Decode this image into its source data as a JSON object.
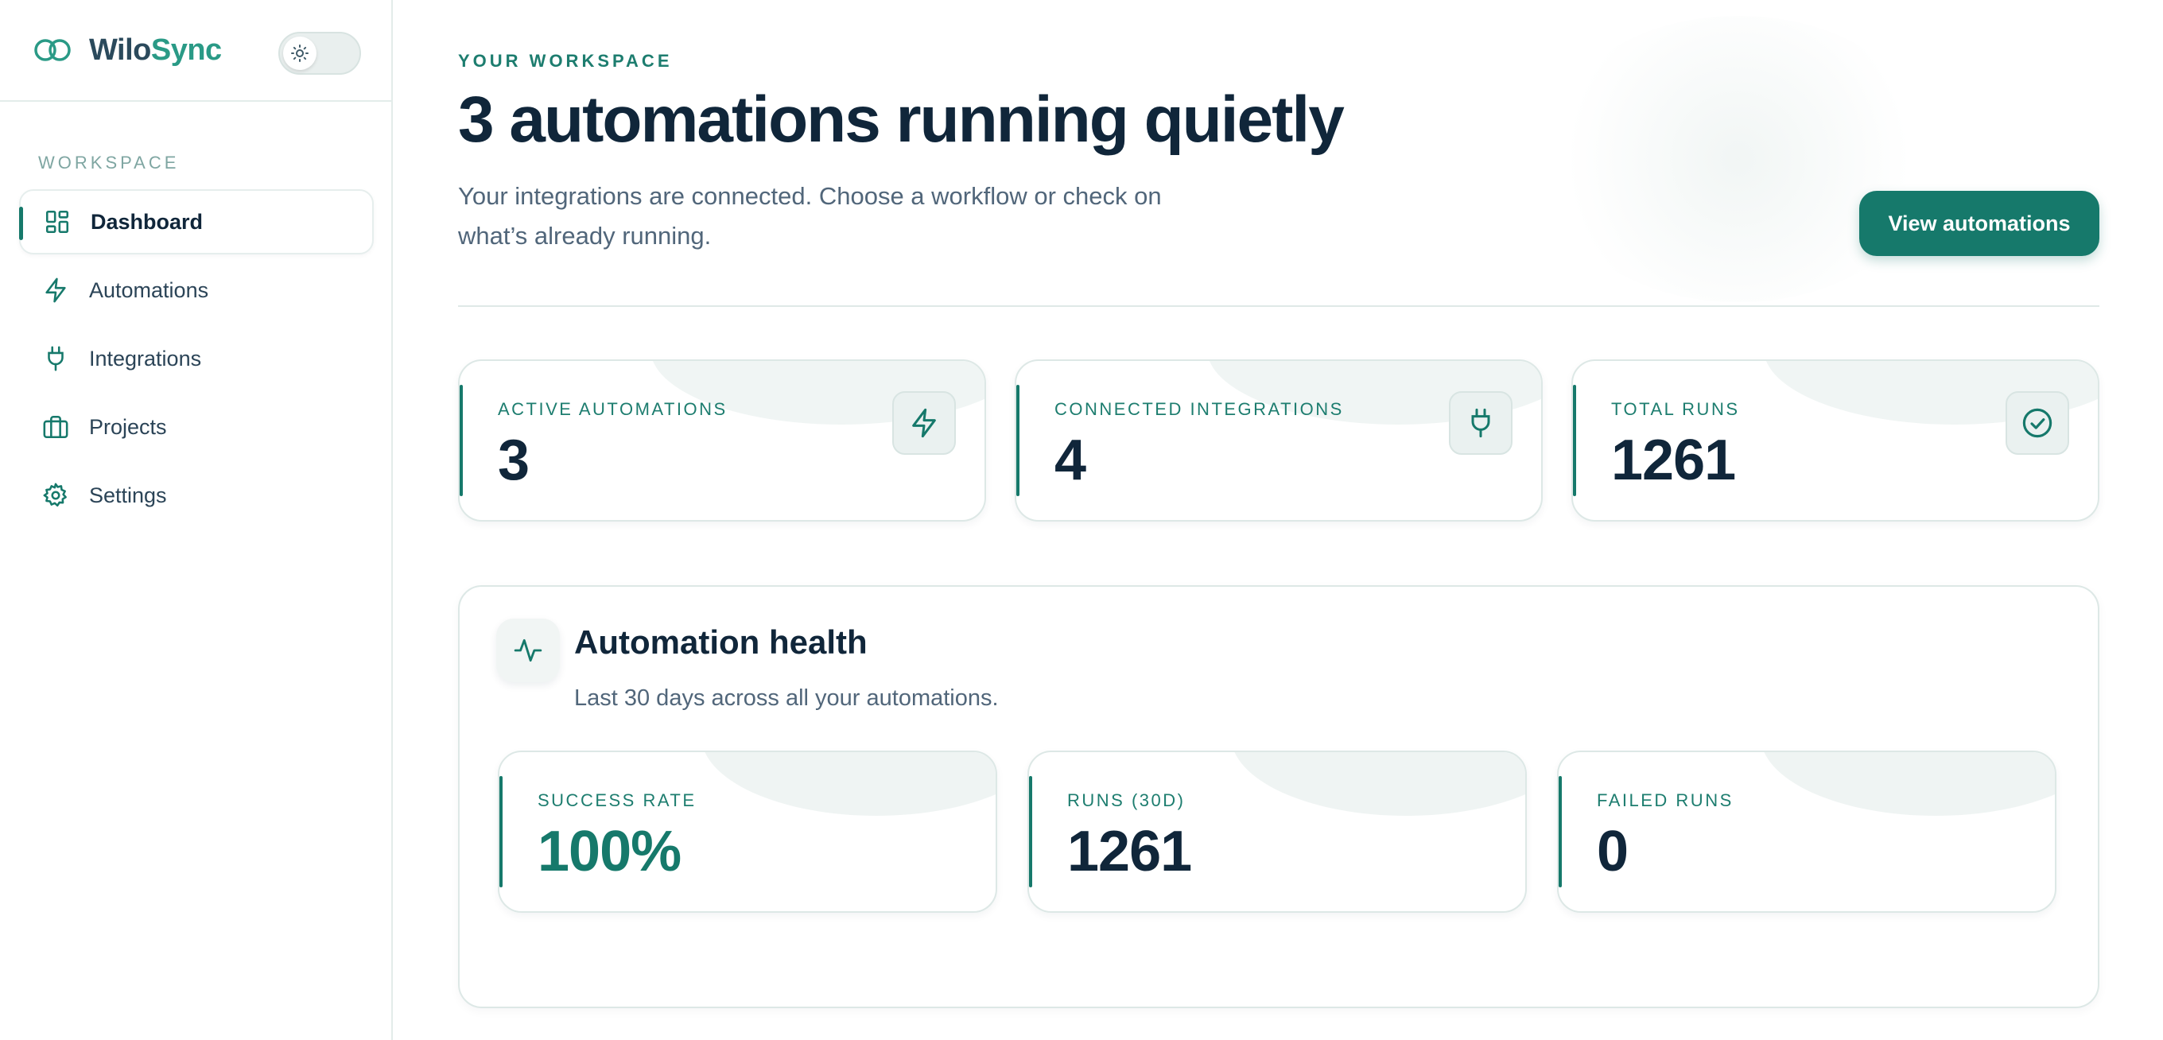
{
  "brand": {
    "name_part1": "Wilo",
    "name_part2": "Sync"
  },
  "sidebar": {
    "section_label": "WORKSPACE",
    "items": [
      {
        "label": "Dashboard",
        "icon": "dashboard-grid-icon",
        "active": true
      },
      {
        "label": "Automations",
        "icon": "lightning-icon",
        "active": false
      },
      {
        "label": "Integrations",
        "icon": "plug-icon",
        "active": false
      },
      {
        "label": "Projects",
        "icon": "briefcase-icon",
        "active": false
      },
      {
        "label": "Settings",
        "icon": "gear-icon",
        "active": false
      }
    ]
  },
  "header": {
    "eyebrow": "YOUR WORKSPACE",
    "title": "3 automations running quietly",
    "subtitle": "Your integrations are connected. Choose a workflow or check on what’s already running.",
    "primary_button": "View automations"
  },
  "stats": [
    {
      "label": "ACTIVE AUTOMATIONS",
      "value": "3",
      "icon": "lightning-icon"
    },
    {
      "label": "CONNECTED INTEGRATIONS",
      "value": "4",
      "icon": "plug-icon"
    },
    {
      "label": "TOTAL RUNS",
      "value": "1261",
      "icon": "check-circle-icon"
    }
  ],
  "health": {
    "title": "Automation health",
    "subtitle": "Last 30 days across all your automations.",
    "metrics": [
      {
        "label": "SUCCESS RATE",
        "value": "100%"
      },
      {
        "label": "RUNS (30D)",
        "value": "1261"
      },
      {
        "label": "FAILED RUNS",
        "value": "0"
      }
    ]
  },
  "colors": {
    "accent": "#16796b",
    "text": "#10263a",
    "muted": "#51667a"
  }
}
